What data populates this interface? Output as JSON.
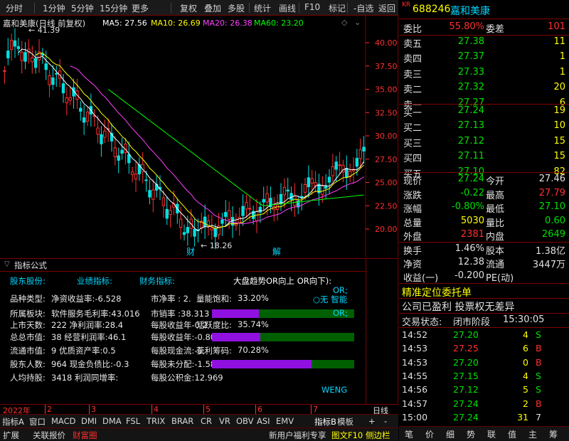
{
  "toolbar": {
    "items": [
      "分时",
      "1分钟",
      "5分钟",
      "15分钟",
      "更多",
      "复权",
      "叠加",
      "多股",
      "统计",
      "画线",
      "F10",
      "标记",
      "-自选",
      "返回"
    ]
  },
  "chart": {
    "title": "嘉和美康(日线 前复权)",
    "ma_labels": [
      {
        "text": "MA5: 27.56",
        "color": "#ffffff"
      },
      {
        "text": "MA10: 26.69",
        "color": "#ffff00"
      },
      {
        "text": "MA20: 26.38",
        "color": "#ff40ff"
      },
      {
        "text": "MA60: 23.20",
        "color": "#00ff00"
      }
    ],
    "high_label": "41.39",
    "low_label": "18.26",
    "marker_cai": "财",
    "marker_jie": "解",
    "y_ticks": [
      "40.00",
      "37.50",
      "35.00",
      "32.50",
      "30.00",
      "27.50",
      "25.00",
      "22.50",
      "20.00"
    ],
    "date_labels": [
      "2022年",
      "2",
      "3",
      "4",
      "5",
      "6",
      "7",
      "日线"
    ]
  },
  "indicator": {
    "title": "指标公式",
    "headers": [
      "股东股份:",
      "业绩指标:",
      "财务指标:",
      "大盘趋势"
    ],
    "overlay_text": "大盘趋势OR向上 OR向下):",
    "or_labels": [
      "OR;",
      "OR;"
    ],
    "circle_labels": "○无 智能",
    "rows": [
      {
        "c1": "品种类型:",
        "c2": "净资收益率:-6.528",
        "c3": "市净率 : 2.",
        "c4": "量能饱和:",
        "c5": "33.20%",
        "bar": 0.35
      },
      {
        "c1": "所属板块:",
        "c2": "软件服务毛利率:43.016",
        "c3": "市销率 :38.313",
        "c4": "",
        "c5": "",
        "bar": 0.33
      },
      {
        "c1": "上市天数:",
        "c2": "222 净利润率:28.4",
        "c3": "每股收益年-0.2",
        "c4": "活跃度比:",
        "c5": "35.74%",
        "bar": 0.0
      },
      {
        "c1": "总总市值:",
        "c2": "38 经营利润率:46.1",
        "c3": "每股收益年:-0.808",
        "c4": "",
        "c5": "",
        "bar": 0.34
      },
      {
        "c1": "流通市值:",
        "c2": "9 优质资产率:0.5",
        "c3": "每股现金流:-1.",
        "c4": "获利筹码:",
        "c5": "70.28%",
        "bar": 0.0
      },
      {
        "c1": "股东人数:",
        "c2": "964 现金负债比:-0.3",
        "c3": "每股未分配:-1.582",
        "c4": "",
        "c5": "",
        "bar": 0.7
      },
      {
        "c1": "人均持股:",
        "c2": "3418 利润同增率:",
        "c3": "每股公积金:12.969",
        "c4": "",
        "c5": "",
        "bar": null
      }
    ],
    "footer": "WENG"
  },
  "tabs1": [
    "指标A",
    "窗口",
    "MACD",
    "DMI",
    "DMA",
    "FSL",
    "TRIX",
    "BRAR",
    "CR",
    "VR",
    "OBV",
    "ASI",
    "EMV",
    "指标B",
    "模板",
    "+",
    "-"
  ],
  "tabs2": [
    "扩展",
    "关联报价",
    "财富圈",
    "新用户福利专享",
    "图文F10",
    "侧边栏"
  ],
  "right": {
    "code_prefix": "KR",
    "code": "688246",
    "name": "嘉和美康",
    "wei_bi_label": "委比",
    "wei_bi": "55.80%",
    "wei_cha_label": "委差",
    "wei_cha": "101",
    "asks": [
      {
        "label": "卖五",
        "price": "27.38",
        "vol": "11"
      },
      {
        "label": "卖四",
        "price": "27.37",
        "vol": "1"
      },
      {
        "label": "卖三",
        "price": "27.33",
        "vol": "1"
      },
      {
        "label": "卖二",
        "price": "27.32",
        "vol": "20"
      },
      {
        "label": "卖一",
        "price": "27.27",
        "vol": "6"
      }
    ],
    "bids": [
      {
        "label": "买一",
        "price": "27.24",
        "vol": "19"
      },
      {
        "label": "买二",
        "price": "27.13",
        "vol": "10"
      },
      {
        "label": "买三",
        "price": "27.12",
        "vol": "15"
      },
      {
        "label": "买四",
        "price": "27.11",
        "vol": "15"
      },
      {
        "label": "买五",
        "price": "27.10",
        "vol": "82"
      }
    ],
    "quote": [
      {
        "l1": "现价",
        "v1": "27.24",
        "c1": "g",
        "l2": "今开",
        "v2": "27.46",
        "c2": "w"
      },
      {
        "l1": "涨跌",
        "v1": "-0.22",
        "c1": "g",
        "l2": "最高",
        "v2": "27.79",
        "c2": "r"
      },
      {
        "l1": "涨幅",
        "v1": "-0.80%",
        "c1": "g",
        "l2": "最低",
        "v2": "27.10",
        "c2": "g"
      },
      {
        "l1": "总量",
        "v1": "5030",
        "c1": "y",
        "l2": "量比",
        "v2": "0.60",
        "c2": "g"
      },
      {
        "l1": "外盘",
        "v1": "2381",
        "c1": "r",
        "l2": "内盘",
        "v2": "2649",
        "c2": "g"
      }
    ],
    "stats": [
      {
        "l1": "换手",
        "v1": "1.46%",
        "l2": "股本",
        "v2": "1.38亿"
      },
      {
        "l1": "净资",
        "v1": "12.38",
        "l2": "流通",
        "v2": "3447万"
      },
      {
        "l1": "收益(一)",
        "v1": "-0.200",
        "l2": "PE(动)",
        "v2": ""
      }
    ],
    "notice1": "精准定位委托单",
    "notice2": "公司已盈利 投票权无差异",
    "status_label": "交易状态:",
    "status_value": "闭市阶段",
    "status_time": "15:30:05",
    "ticks": [
      {
        "t": "14:52",
        "p": "27.20",
        "v": "4",
        "d": "S"
      },
      {
        "t": "14:53",
        "p": "27.25",
        "v": "6",
        "d": "B"
      },
      {
        "t": "14:53",
        "p": "27.20",
        "v": "0",
        "d": "B"
      },
      {
        "t": "14:55",
        "p": "27.15",
        "v": "4",
        "d": "S"
      },
      {
        "t": "14:56",
        "p": "27.12",
        "v": "5",
        "d": "S"
      },
      {
        "t": "14:57",
        "p": "27.24",
        "v": "2",
        "d": "B"
      },
      {
        "t": "15:00",
        "p": "27.24",
        "v": "31",
        "d": "7"
      }
    ],
    "bottom_tabs": [
      "笔",
      "价",
      "细",
      "势",
      "联",
      "值",
      "主",
      "筹"
    ]
  },
  "colors": {
    "up": "#ff3030",
    "down": "#00e0e0",
    "ma5": "#ffffff",
    "ma10": "#ffff00",
    "ma20": "#ff40ff",
    "ma60": "#00ff00",
    "axis": "#ff3030"
  }
}
